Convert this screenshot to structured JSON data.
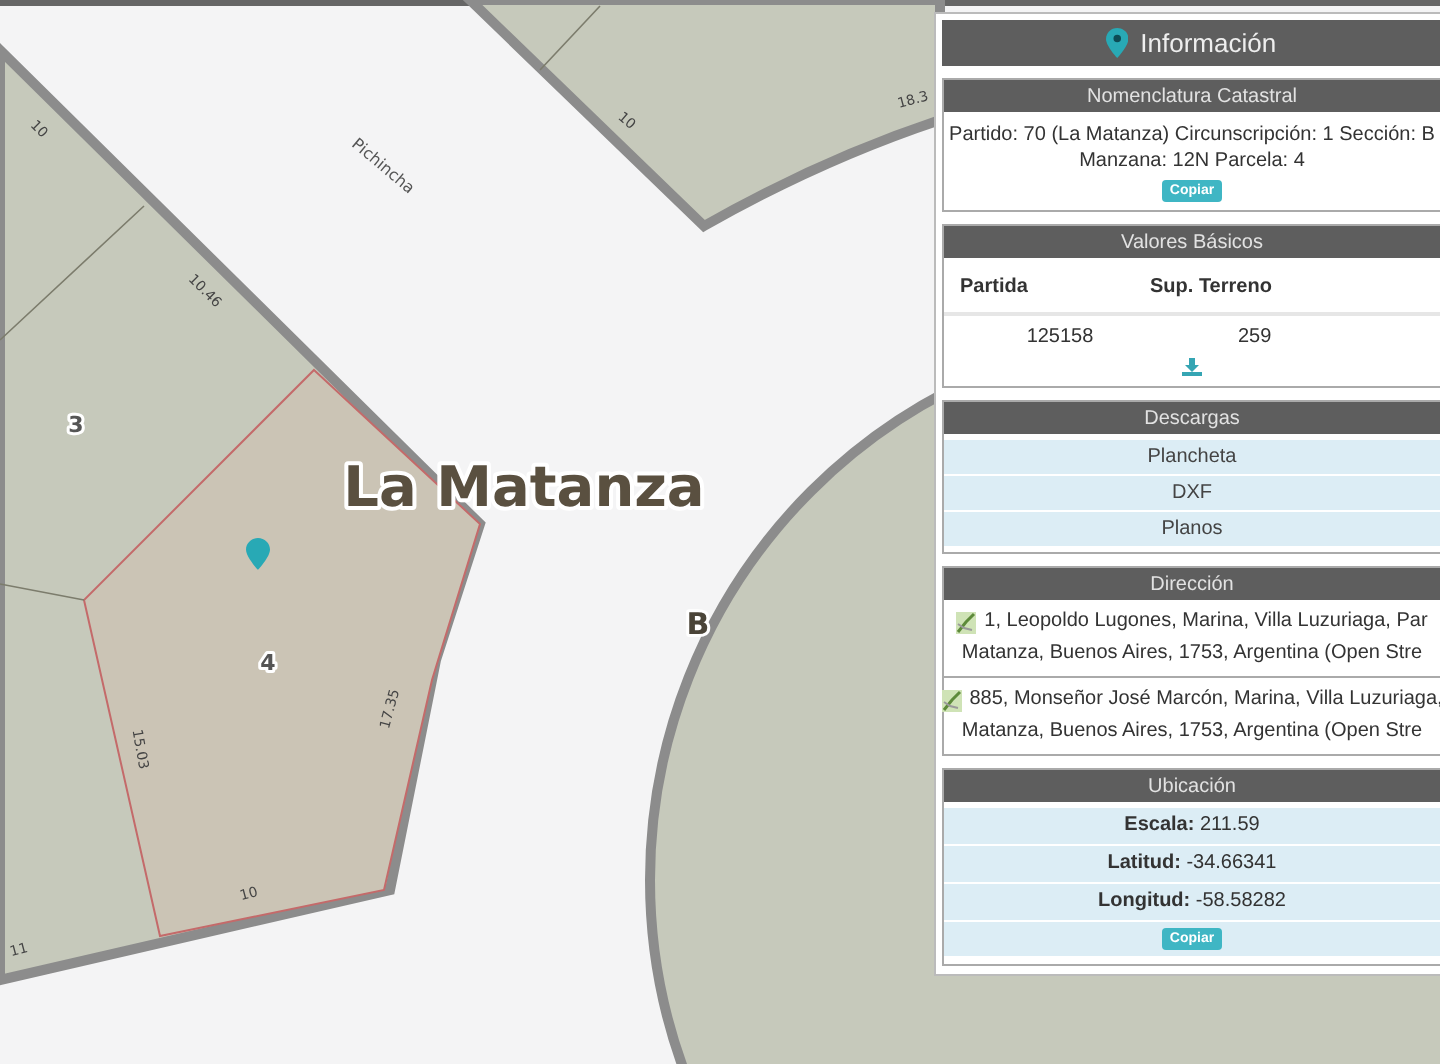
{
  "map": {
    "place_name": "La Matanza",
    "block_label": "B",
    "street": "Pichincha",
    "parcels": [
      "3",
      "4"
    ],
    "measurements": [
      "10",
      "10",
      "18.3",
      "10.46",
      "15.03",
      "17.35",
      "10",
      "11"
    ]
  },
  "panel": {
    "title": "Información",
    "sections": [
      {
        "kind": "text",
        "title": "Nomenclatura Catastral",
        "lines": [
          "Partido: 70 (La Matanza) Circunscripción: 1 Sección: B",
          "Manzana: 12N Parcela: 4"
        ],
        "button": "Copiar"
      },
      {
        "kind": "table",
        "title": "Valores Básicos",
        "columns": [
          "Partida",
          "Sup. Terreno"
        ],
        "rows": [
          [
            "125158",
            "259"
          ]
        ]
      },
      {
        "kind": "links",
        "title": "Descargas",
        "items": [
          "Plancheta",
          "DXF",
          "Planos"
        ]
      },
      {
        "kind": "addresses",
        "title": "Dirección",
        "items": [
          {
            "lines": [
              "1, Leopoldo Lugones, Marina, Villa Luzuriaga, Par",
              "Matanza, Buenos Aires, 1753, Argentina (Open Stre"
            ]
          },
          {
            "lines": [
              "885, Monseñor José Marcón, Marina, Villa Luzuriaga,",
              "Matanza, Buenos Aires, 1753, Argentina (Open Stre"
            ]
          }
        ]
      },
      {
        "kind": "fields",
        "title": "Ubicación",
        "items": [
          {
            "label": "Escala:",
            "value": "211.59"
          },
          {
            "label": "Latitud:",
            "value": "-34.66341"
          },
          {
            "label": "Longitud:",
            "value": "-58.58282"
          }
        ],
        "button": "Copiar"
      }
    ]
  }
}
